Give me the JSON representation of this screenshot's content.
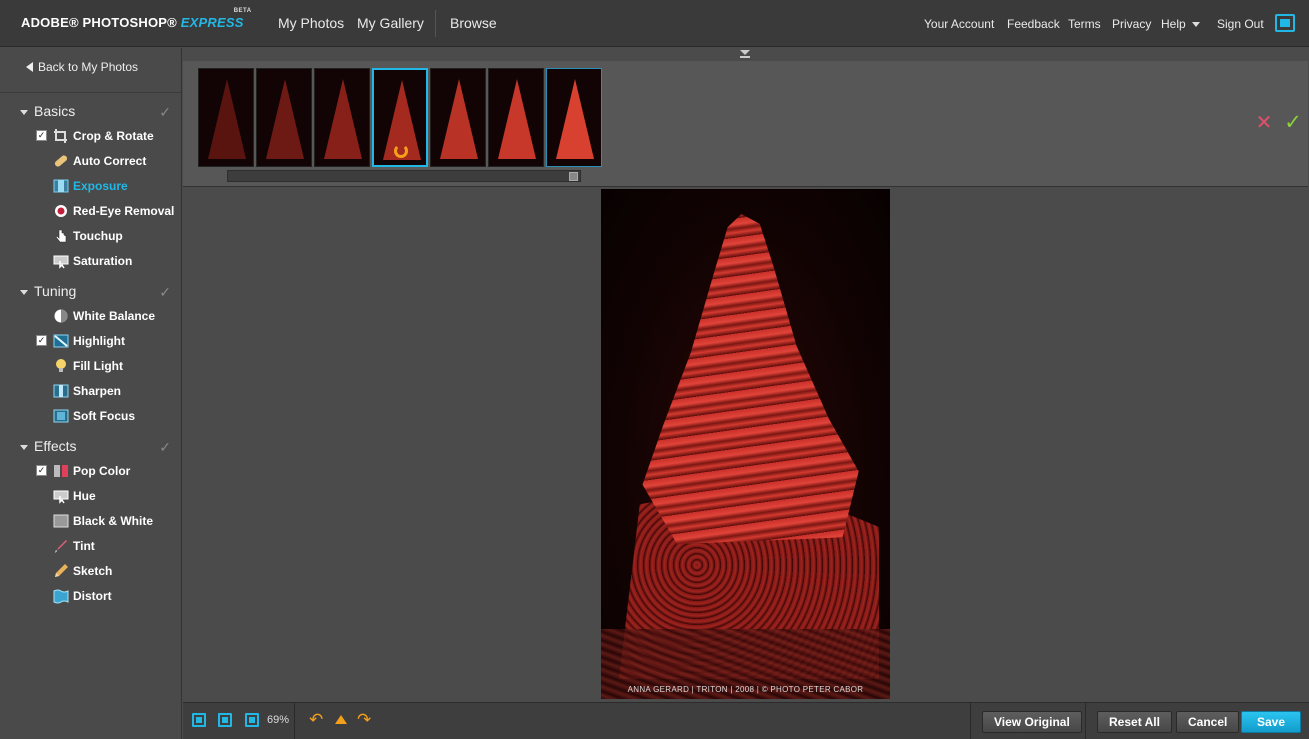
{
  "header": {
    "logo_main": "ADOBE® PHOTOSHOP® ",
    "logo_express": "EXPRESS",
    "logo_beta": "BETA",
    "nav": [
      "My Photos",
      "My Gallery",
      "Browse"
    ],
    "right_links": [
      "Your Account",
      "Feedback",
      "Terms",
      "Privacy",
      "Help",
      "Sign Out"
    ]
  },
  "sidebar": {
    "back_label": "Back to My Photos",
    "sections": [
      {
        "title": "Basics",
        "tools": [
          {
            "label": "Crop & Rotate",
            "checked": true,
            "icon": "crop-icon"
          },
          {
            "label": "Auto Correct",
            "checked": false,
            "icon": "bandage-icon"
          },
          {
            "label": "Exposure",
            "checked": false,
            "icon": "exposure-icon",
            "active": true
          },
          {
            "label": "Red-Eye Removal",
            "checked": false,
            "icon": "eye-icon"
          },
          {
            "label": "Touchup",
            "checked": false,
            "icon": "hand-icon"
          },
          {
            "label": "Saturation",
            "checked": false,
            "icon": "saturation-icon"
          }
        ]
      },
      {
        "title": "Tuning",
        "tools": [
          {
            "label": "White Balance",
            "checked": false,
            "icon": "white-balance-icon"
          },
          {
            "label": "Highlight",
            "checked": true,
            "icon": "highlight-icon"
          },
          {
            "label": "Fill Light",
            "checked": false,
            "icon": "lightbulb-icon"
          },
          {
            "label": "Sharpen",
            "checked": false,
            "icon": "sharpen-icon"
          },
          {
            "label": "Soft Focus",
            "checked": false,
            "icon": "soft-focus-icon"
          }
        ]
      },
      {
        "title": "Effects",
        "tools": [
          {
            "label": "Pop Color",
            "checked": true,
            "icon": "pop-color-icon"
          },
          {
            "label": "Hue",
            "checked": false,
            "icon": "hue-icon"
          },
          {
            "label": "Black & White",
            "checked": false,
            "icon": "black-white-icon"
          },
          {
            "label": "Tint",
            "checked": false,
            "icon": "tint-icon"
          },
          {
            "label": "Sketch",
            "checked": false,
            "icon": "sketch-icon"
          },
          {
            "label": "Distort",
            "checked": false,
            "icon": "distort-icon"
          }
        ]
      }
    ]
  },
  "filmstrip": {
    "selected_index": 3,
    "count": 7
  },
  "photo": {
    "caption": "ANNA GERARD | TRITON | 2008 | © PHOTO PETER CABOR"
  },
  "bottombar": {
    "zoom": "69%",
    "view_original": "View Original",
    "reset_all": "Reset All",
    "cancel": "Cancel",
    "save": "Save"
  },
  "colors": {
    "accent": "#22b8e6",
    "undo": "#f5a01a",
    "reject": "#e0506a",
    "accept": "#8cd13a"
  }
}
